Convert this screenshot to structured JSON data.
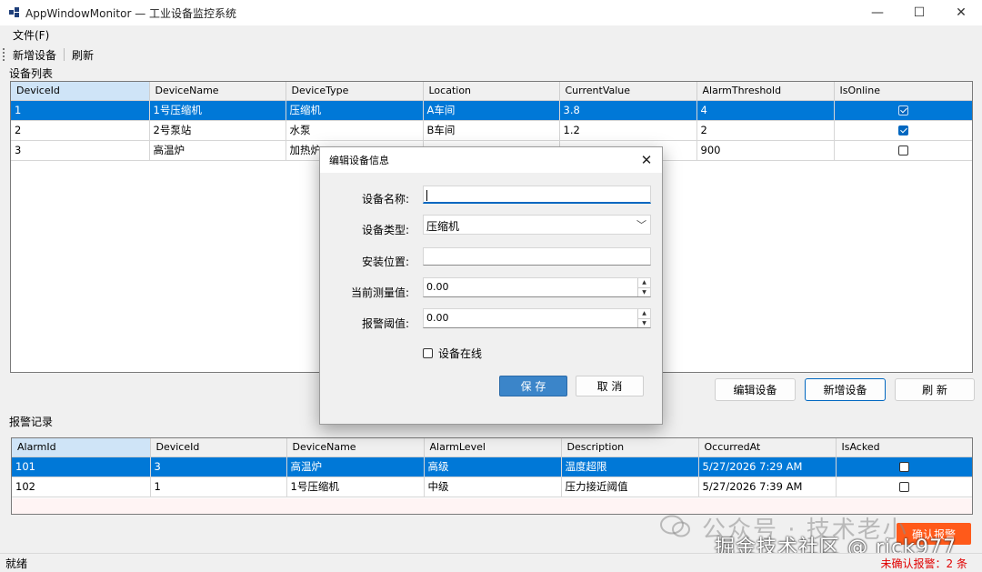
{
  "window": {
    "title": "AppWindowMonitor — 工业设备监控系统",
    "minimize": "—",
    "maximize": "☐",
    "close": "✕"
  },
  "menu": {
    "file": "文件(F)"
  },
  "toolbar": {
    "add": "新增设备",
    "refresh": "刷新"
  },
  "devices": {
    "group_label": "设备列表",
    "columns": [
      "DeviceId",
      "DeviceName",
      "DeviceType",
      "Location",
      "CurrentValue",
      "AlarmThreshold",
      "IsOnline"
    ],
    "rows": [
      {
        "id": "1",
        "name": "1号压缩机",
        "type": "压缩机",
        "location": "A车间",
        "value": "3.8",
        "threshold": "4",
        "online": true
      },
      {
        "id": "2",
        "name": "2号泵站",
        "type": "水泵",
        "location": "B车间",
        "value": "1.2",
        "threshold": "2",
        "online": true
      },
      {
        "id": "3",
        "name": "高温炉",
        "type": "加热炉",
        "location": "",
        "value": "",
        "threshold": "900",
        "online": false
      }
    ]
  },
  "device_buttons": {
    "edit": "编辑设备",
    "add": "新增设备",
    "refresh": "刷 新"
  },
  "alarms": {
    "group_label": "报警记录",
    "columns": [
      "AlarmId",
      "DeviceId",
      "DeviceName",
      "AlarmLevel",
      "Description",
      "OccurredAt",
      "IsAcked"
    ],
    "rows": [
      {
        "id": "101",
        "device_id": "3",
        "device_name": "高温炉",
        "level": "高级",
        "description": "温度超限",
        "occurred": "5/27/2026 7:29 AM",
        "acked": false
      },
      {
        "id": "102",
        "device_id": "1",
        "device_name": "1号压缩机",
        "level": "中级",
        "description": "压力接近阈值",
        "occurred": "5/27/2026 7:39 AM",
        "acked": false
      }
    ]
  },
  "ack_button": "确认报警",
  "status": {
    "left": "就绪",
    "right": "未确认报警：2 条"
  },
  "watermark": {
    "line1": "公众号 · 技术老小",
    "line2": "掘金技术社区 @ rick977"
  },
  "dialog": {
    "title": "编辑设备信息",
    "name_label": "设备名称:",
    "name_value": "",
    "type_label": "设备类型:",
    "type_value": "压缩机",
    "location_label": "安装位置:",
    "location_value": "",
    "current_label": "当前测量值:",
    "current_value": "0.00",
    "threshold_label": "报警阈值:",
    "threshold_value": "0.00",
    "online_label": "设备在线",
    "save": "保 存",
    "cancel": "取 消"
  },
  "colors": {
    "selection": "#0078d7",
    "alarm_text": "#e00000",
    "ack_button": "#ff5a1a"
  }
}
